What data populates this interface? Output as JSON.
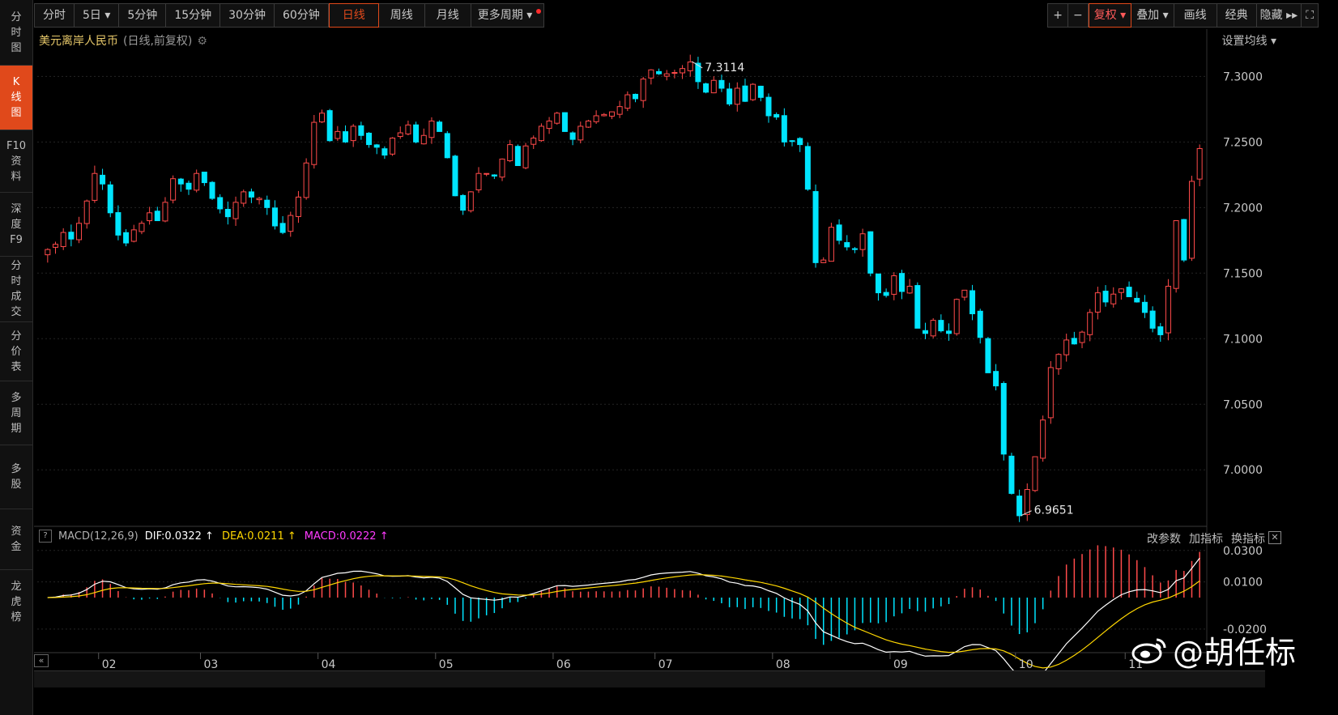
{
  "sidebar": {
    "items": [
      {
        "label": "分\n时\n图",
        "active": false
      },
      {
        "label": "K\n线\n图",
        "active": true
      },
      {
        "label": "F10\n资\n料",
        "active": false
      },
      {
        "label": "深\n度\nF9",
        "active": false
      },
      {
        "label": "分\n时\n成\n交",
        "active": false
      },
      {
        "label": "分\n价\n表",
        "active": false
      },
      {
        "label": "多\n周\n期",
        "active": false
      },
      {
        "label": "多\n股",
        "active": false
      },
      {
        "label": "资\n金",
        "active": false
      },
      {
        "label": "龙\n虎\n榜",
        "active": false
      }
    ]
  },
  "toolbar": {
    "periods": [
      "分时",
      "5日 ▾",
      "5分钟",
      "15分钟",
      "30分钟",
      "60分钟",
      "日线",
      "周线",
      "月线",
      "更多周期 ▾"
    ],
    "active_period": "日线",
    "right": [
      "+",
      "−",
      "复权 ▾",
      "叠加 ▾",
      "画线",
      "经典",
      "隐藏 ▸▸",
      "⛶"
    ],
    "active_right": "复权 ▾"
  },
  "symbol": {
    "name": "美元离岸人民币",
    "subtitle": "(日线,前复权)",
    "gear_icon": "gear-icon"
  },
  "ma_setting": "设置均线 ▾",
  "macd": {
    "name": "MACD(12,26,9)",
    "dif_text": "DIF:0.0322 ↑",
    "dea_text": "DEA:0.0211 ↑",
    "macd_text": "MACD:0.0222 ↑",
    "tools": [
      "改参数",
      "加指标",
      "换指标"
    ],
    "help_label": "?",
    "close_label": "✕"
  },
  "colors": {
    "up": "#ff4a4a",
    "down": "#00e5ff",
    "dif": "#ffffff",
    "dea": "#ffd700",
    "accent": "#e0491b"
  },
  "chart_data": {
    "type": "candlestick",
    "ylim": [
      6.96,
      7.32
    ],
    "y_ticks": [
      "7.3000",
      "7.2500",
      "7.2000",
      "7.1500",
      "7.1000",
      "7.0500",
      "7.0000"
    ],
    "x_ticks": [
      "02",
      "03",
      "04",
      "05",
      "06",
      "07",
      "08",
      "09",
      "10",
      "11"
    ],
    "annotations": [
      {
        "label": "7.3114",
        "value": 7.3114
      },
      {
        "label": "6.9651",
        "value": 6.9651
      }
    ],
    "close_series": [
      7.168,
      7.172,
      7.181,
      7.176,
      7.188,
      7.205,
      7.226,
      7.218,
      7.196,
      7.179,
      7.173,
      7.183,
      7.188,
      7.196,
      7.19,
      7.204,
      7.222,
      7.218,
      7.214,
      7.226,
      7.219,
      7.207,
      7.199,
      7.193,
      7.204,
      7.212,
      7.208,
      7.207,
      7.2,
      7.186,
      7.181,
      7.194,
      7.208,
      7.234,
      7.265,
      7.272,
      7.251,
      7.258,
      7.25,
      7.262,
      7.255,
      7.248,
      7.246,
      7.24,
      7.253,
      7.257,
      7.263,
      7.25,
      7.255,
      7.266,
      7.258,
      7.238,
      7.209,
      7.198,
      7.212,
      7.226,
      7.226,
      7.224,
      7.237,
      7.248,
      7.232,
      7.247,
      7.253,
      7.262,
      7.266,
      7.272,
      7.258,
      7.252,
      7.262,
      7.266,
      7.27,
      7.271,
      7.273,
      7.277,
      7.286,
      7.283,
      7.298,
      7.305,
      7.302,
      7.302,
      7.303,
      7.306,
      7.311,
      7.296,
      7.288,
      7.297,
      7.291,
      7.279,
      7.291,
      7.281,
      7.294,
      7.284,
      7.27,
      7.269,
      7.25,
      7.251,
      7.248,
      7.214,
      7.158,
      7.16,
      7.185,
      7.175,
      7.17,
      7.168,
      7.18,
      7.15,
      7.135,
      7.133,
      7.148,
      7.136,
      7.14,
      7.108,
      7.104,
      7.114,
      7.106,
      7.104,
      7.13,
      7.137,
      7.119,
      7.101,
      7.074,
      7.064,
      7.012,
      6.982,
      6.965,
      6.985,
      7.01,
      7.038,
      7.078,
      7.088,
      7.099,
      7.096,
      7.105,
      7.12,
      7.135,
      7.128,
      7.134,
      7.138,
      7.132,
      7.128,
      7.12,
      7.108,
      7.103,
      7.14,
      7.19,
      7.16,
      7.22,
      7.245
    ],
    "macd_ylim": [
      -0.034,
      0.034
    ],
    "macd_ticks": [
      "0.0300",
      "0.0100",
      "-0.0200"
    ],
    "macd_last": {
      "dif": 0.0322,
      "dea": 0.0211,
      "macd": 0.0222
    }
  },
  "watermark": "@胡任标"
}
